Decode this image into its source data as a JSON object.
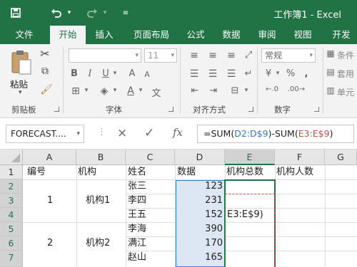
{
  "title_bar": {
    "title": "工作簿1 - Excel",
    "save_icon": "save-icon",
    "undo_icon": "undo-icon",
    "redo_icon": "redo-icon",
    "customize_icon": "customize-qat-icon"
  },
  "tabs": [
    "文件",
    "开始",
    "插入",
    "页面布局",
    "公式",
    "数据",
    "审阅",
    "视图",
    "开发"
  ],
  "active_tab": "开始",
  "ribbon": {
    "clipboard": {
      "paste_label": "粘贴",
      "group_label": "剪贴板"
    },
    "font": {
      "font_name": "",
      "font_size": "11",
      "group_label": "字体"
    },
    "alignment": {
      "group_label": "对齐方式"
    },
    "number": {
      "format": "常规",
      "group_label": "数字"
    },
    "styles": {
      "item1": "条件",
      "item2": "套用",
      "item3": "单元"
    }
  },
  "formula_bar": {
    "name_box": "FORECAST....",
    "cancel_icon": "×",
    "enter_icon": "✓",
    "fx_label": "fx",
    "formula_parts": [
      "=SUM(",
      "D2:D$9",
      ")-SUM(",
      "E3:E$9",
      ")"
    ]
  },
  "sheet": {
    "columns": [
      "A",
      "B",
      "C",
      "D",
      "E",
      "F",
      "G"
    ],
    "rows": [
      "1",
      "2",
      "3",
      "4",
      "5",
      "6",
      "7"
    ],
    "headers": {
      "A": "编号",
      "B": "机构",
      "C": "姓名",
      "D": "数据",
      "E": "机构总数",
      "F": "机构人数"
    },
    "ids": [
      "1",
      "2"
    ],
    "orgs": [
      "机构1",
      "机构2"
    ],
    "names": [
      "张三",
      "李四",
      "王五",
      "李海",
      "满江",
      "赵山"
    ],
    "values": [
      "123",
      "231",
      "152",
      "390",
      "170",
      "165"
    ],
    "editing_cell_text": "E3:E$9)"
  },
  "colors": {
    "brand": "#217346",
    "ref_blue": "#3c78c8",
    "ref_red": "#c0504d"
  }
}
